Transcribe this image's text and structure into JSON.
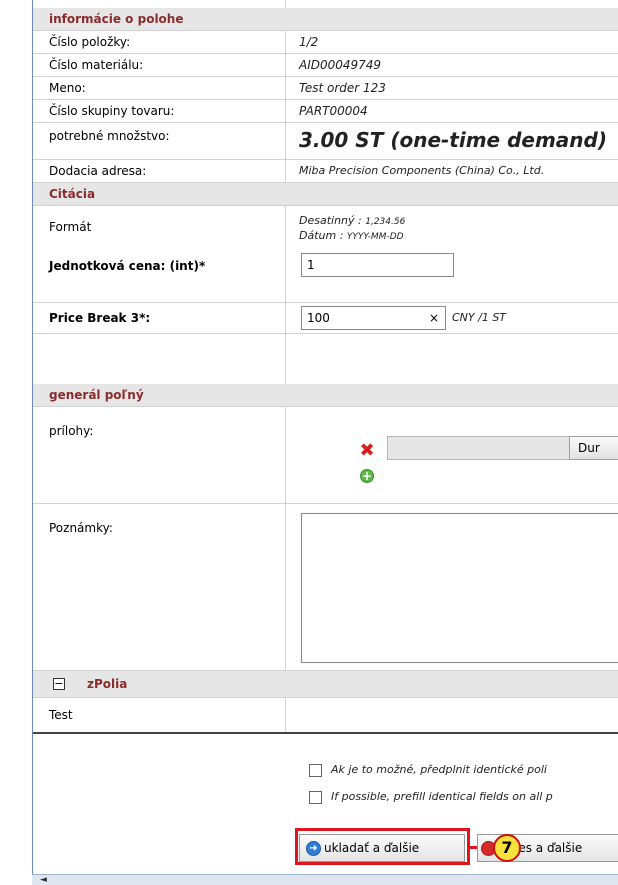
{
  "position_section": {
    "title": "informácie o polohe",
    "rows": [
      {
        "label": "Číslo položky:",
        "value": "1/2"
      },
      {
        "label": "Číslo materiálu:",
        "value": "AID00049749"
      },
      {
        "label": "Meno:",
        "value": "Test order 123"
      },
      {
        "label": "Číslo skupiny tovaru:",
        "value": "PART00004"
      },
      {
        "label": "potrebné množstvo:",
        "value": "3.00 ST (one-time demand)"
      },
      {
        "label": "Dodacia adresa:",
        "value": "Miba Precision Components (China) Co., Ltd."
      }
    ]
  },
  "quotation_section": {
    "title": "Citácia",
    "format_label": "Formát",
    "decimal_label": "Desatinný :",
    "decimal_value": "1,234.56",
    "date_label": "Dátum :",
    "date_value": "YYYY-MM-DD",
    "unit_price_label": "Jednotková cena: (int)*",
    "unit_price_value": "1",
    "price_break_label": "Price Break 3*:",
    "price_break_value": "100",
    "price_break_clear": "×",
    "price_break_unit": "CNY /1 ST"
  },
  "general_section": {
    "title": "generál poľný",
    "attachments_label": "prílohy:",
    "browse_label": "Dur",
    "notes_label": "Poznámky:",
    "notes_value": ""
  },
  "zpolia_section": {
    "toggle": "−",
    "title": "zPolia",
    "test_label": "Test"
  },
  "options": {
    "prefill_cz": "Ak je to možné, předplnit identické poli",
    "prefill_en": "If possible, prefill identical fields on all p"
  },
  "actions": {
    "save_next": "ukladať a ďalšie",
    "next_partial": "les a ďalšie",
    "step_badge": "7"
  },
  "colors": {
    "section_text": "#8b2c2c",
    "section_bg": "#e6e6e6",
    "highlight": "#e0141e",
    "badge_bg": "#f7e23c"
  }
}
